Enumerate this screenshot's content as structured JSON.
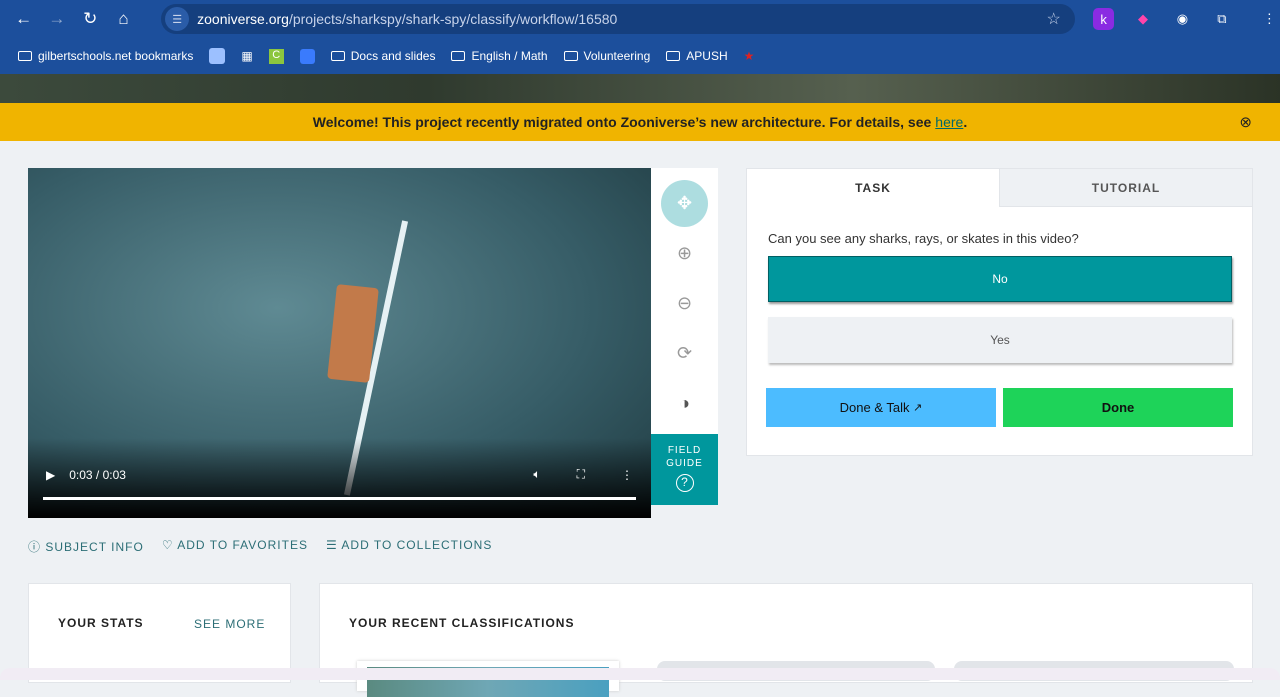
{
  "browser": {
    "url_domain": "zooniverse.org",
    "url_path": "/projects/sharkspy/shark-spy/classify/workflow/16580",
    "bookmarks": [
      "gilbertschools.net bookmarks",
      "Docs and slides",
      "English / Math",
      "Volunteering",
      "APUSH"
    ]
  },
  "banner": {
    "text": "Welcome! This project recently migrated onto Zooniverse’s new architecture. For details, see",
    "link": "here",
    "end": "."
  },
  "video": {
    "time": "0:03 / 0:03",
    "progress": 1.0
  },
  "field_guide": {
    "label1": "FIELD",
    "label2": "GUIDE"
  },
  "task": {
    "tabs": [
      "TASK",
      "TUTORIAL"
    ],
    "question": "Can you see any sharks, rays, or skates in this video?",
    "answers": [
      "No",
      "Yes"
    ],
    "selected": "No",
    "done_talk": "Done & Talk",
    "done": "Done"
  },
  "meta": [
    "SUBJECT INFO",
    "ADD TO FAVORITES",
    "ADD TO COLLECTIONS"
  ],
  "stats": {
    "title": "YOUR STATS",
    "see_more": "SEE MORE"
  },
  "recent": {
    "title": "YOUR RECENT CLASSIFICATIONS"
  },
  "colors": {
    "teal": "#00979d",
    "blue": "#4cbcff",
    "green": "#1ed359",
    "banner": "#f0b400"
  }
}
